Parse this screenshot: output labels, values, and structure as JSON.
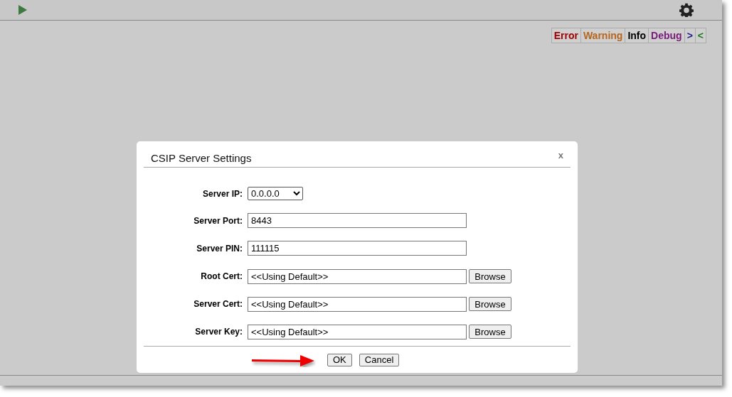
{
  "log_filters": [
    {
      "label": "Error",
      "color": "#a00000"
    },
    {
      "label": "Warning",
      "color": "#b5651d"
    },
    {
      "label": "Info",
      "color": "#000000"
    },
    {
      "label": "Debug",
      "color": "#7a1a7a"
    },
    {
      "label": ">",
      "color": "#1a1a8a"
    },
    {
      "label": "<",
      "color": "#1a7a1a"
    }
  ],
  "dialog": {
    "title": "CSIP Server Settings",
    "close": "x",
    "fields": [
      {
        "kind": "select",
        "label": "Server IP:",
        "value": "0.0.0.0"
      },
      {
        "kind": "text",
        "label": "Server Port:",
        "value": "8443"
      },
      {
        "kind": "text",
        "label": "Server PIN:",
        "value": "111115"
      },
      {
        "kind": "file",
        "label": "Root Cert:",
        "value": "<<Using Default>>",
        "button": "Browse"
      },
      {
        "kind": "file",
        "label": "Server Cert:",
        "value": "<<Using Default>>",
        "button": "Browse"
      },
      {
        "kind": "file",
        "label": "Server Key:",
        "value": "<<Using Default>>",
        "button": "Browse"
      }
    ],
    "buttons": [
      "OK",
      "Cancel"
    ]
  }
}
